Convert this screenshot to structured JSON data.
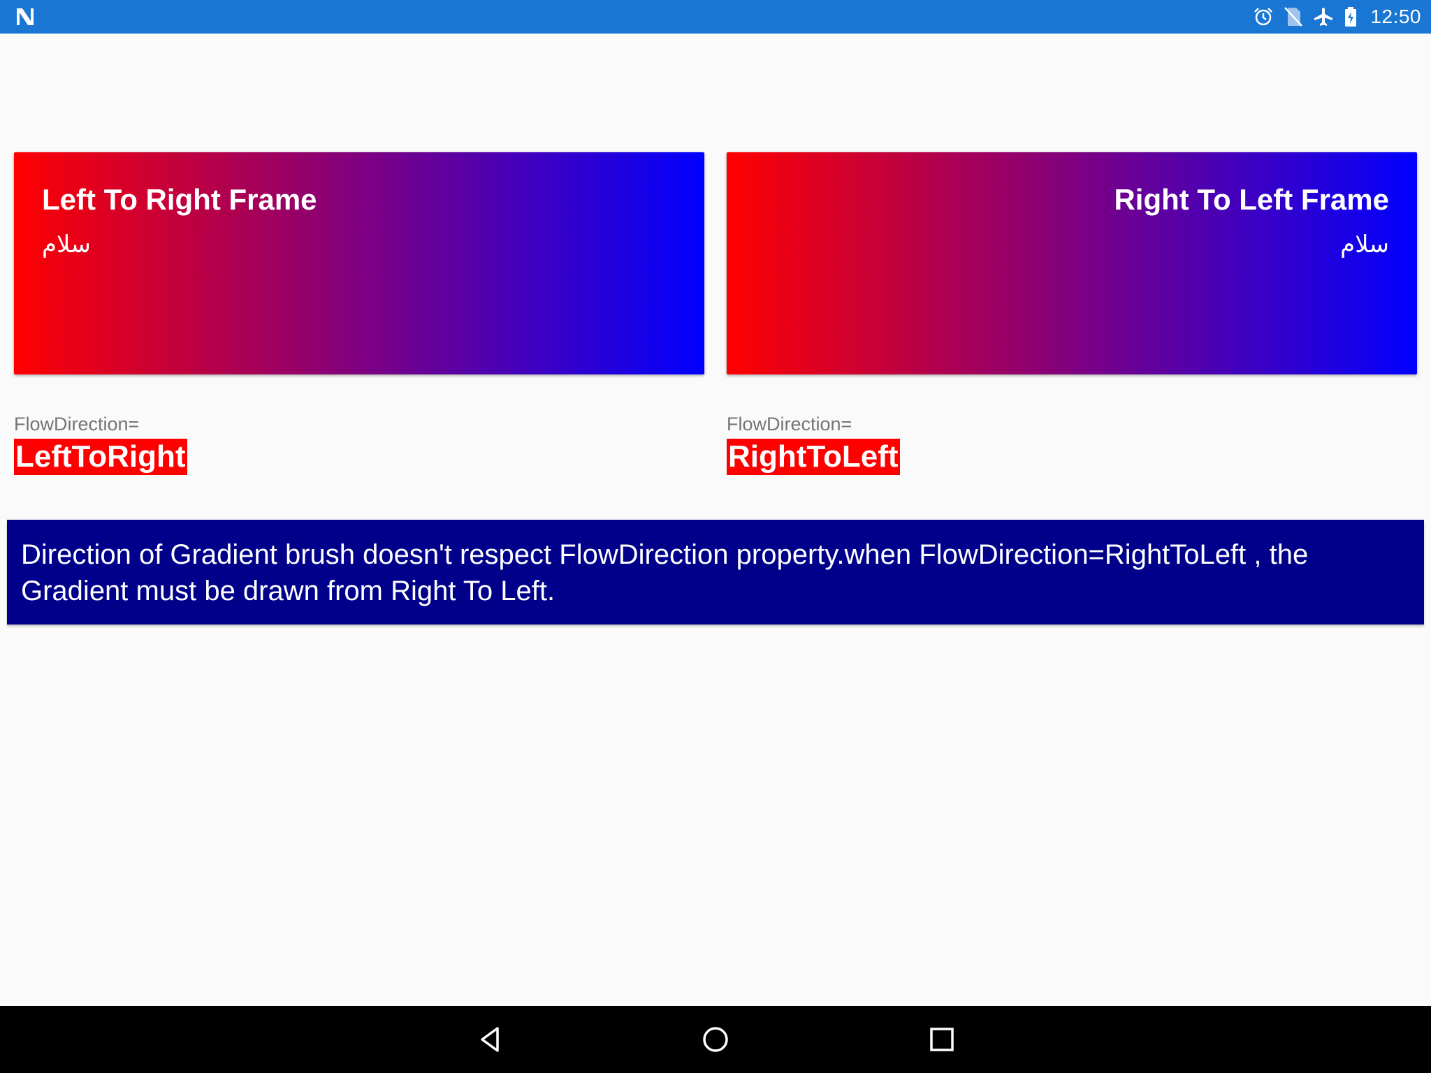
{
  "status_bar": {
    "time": "12:50",
    "icons": [
      "notification-n-icon",
      "alarm-icon",
      "no-sim-icon",
      "airplane-icon",
      "battery-charging-icon"
    ]
  },
  "frames": {
    "ltr": {
      "title": "Left To Right Frame",
      "arabic": "سلام",
      "gradient_start": "#ff0000",
      "gradient_end": "#0000ff"
    },
    "rtl": {
      "title": "Right To Left Frame",
      "arabic": "سلام",
      "gradient_start": "#ff0000",
      "gradient_end": "#0000ff"
    }
  },
  "flow_labels": {
    "ltr": {
      "caption": "FlowDirection=",
      "value": "LeftToRight"
    },
    "rtl": {
      "caption": "FlowDirection=",
      "value": "RightToLeft"
    }
  },
  "info_banner": {
    "text": "Direction of Gradient brush doesn't respect FlowDirection property.when FlowDirection=RightToLeft , the Gradient must be drawn from Right To Left.",
    "background": "#00008b"
  },
  "nav_bar": {
    "buttons": [
      "back-icon",
      "home-icon",
      "recents-icon"
    ]
  },
  "colors": {
    "status_bar": "#1976d2",
    "highlight": "#ff0000"
  }
}
